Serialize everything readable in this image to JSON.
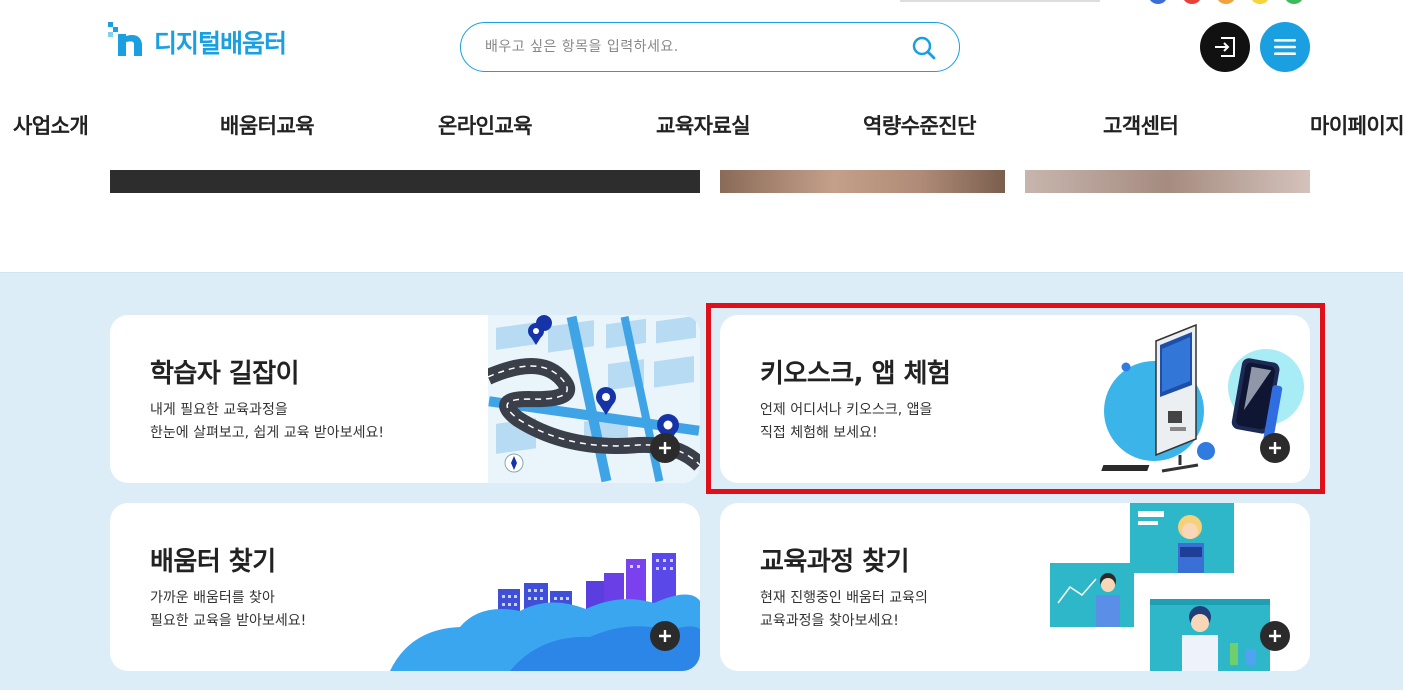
{
  "header": {
    "logo_text": "디지털배움터",
    "search": {
      "placeholder": "배우고 싶은 항목을 입력하세요."
    }
  },
  "nav": {
    "items": [
      {
        "label": "사업소개"
      },
      {
        "label": "배움터교육"
      },
      {
        "label": "온라인교육"
      },
      {
        "label": "교육자료실"
      },
      {
        "label": "역량수준진단"
      },
      {
        "label": "고객센터"
      },
      {
        "label": "마이페이지"
      }
    ]
  },
  "cards": [
    {
      "title": "학습자 길잡이",
      "desc": [
        "내게 필요한 교육과정을",
        "한눈에 살펴보고, 쉽게 교육 받아보세요!"
      ],
      "icon": "map-route"
    },
    {
      "title": "키오스크, 앱 체험",
      "desc": [
        "언제 어디서나 키오스크, 앱을",
        "직접 체험해 보세요!"
      ],
      "icon": "kiosk-phone"
    },
    {
      "title": "배움터 찾기",
      "desc": [
        "가까운 배움터를 찾아",
        "필요한 교육을 받아보세요!"
      ],
      "icon": "city-cloud"
    },
    {
      "title": "교육과정 찾기",
      "desc": [
        "현재 진행중인 배움터 교육의",
        "교육과정을 찾아보세요!"
      ],
      "icon": "teachers"
    }
  ],
  "colors": {
    "brand": "#1a9fe0",
    "section_bg": "#dcedf7",
    "highlight": "#e0101a"
  }
}
